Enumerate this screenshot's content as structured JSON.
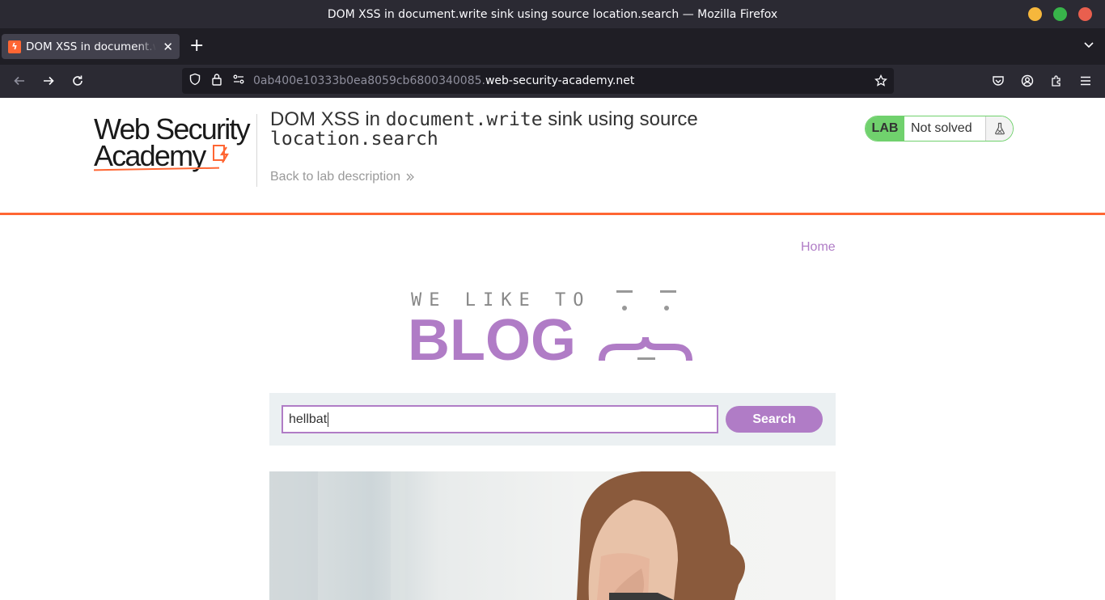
{
  "window": {
    "title": "DOM XSS in document.write sink using source location.search — Mozilla Firefox"
  },
  "tabs": [
    {
      "label": "DOM XSS in document.write sink using source location.search",
      "active": true
    }
  ],
  "urlbar": {
    "subdomain": "0ab400e10333b0ea8059cb6800340085.",
    "domain": "web-security-academy.net"
  },
  "lab": {
    "logo_line1": "Web Security",
    "logo_line2": "Academy",
    "title_prefix": "DOM XSS in ",
    "title_code1": "document.write",
    "title_middle": " sink using source",
    "title_code2": "location.search",
    "back_link": "Back to lab description",
    "badge": "LAB",
    "status": "Not solved"
  },
  "blog": {
    "nav_home": "Home",
    "banner_top": "WE LIKE TO",
    "banner_main": "BLOG",
    "search_value": "hellbat",
    "search_button": "Search"
  },
  "colors": {
    "accent_orange": "#ff6633",
    "blog_purple": "#b07cc6",
    "lab_green": "#70d16d"
  }
}
